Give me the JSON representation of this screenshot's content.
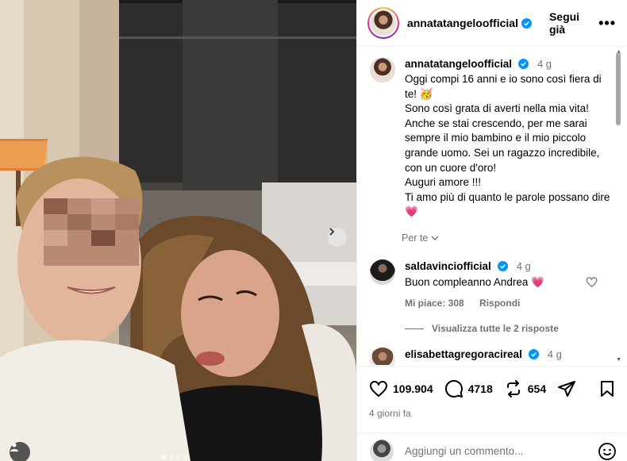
{
  "post": {
    "author": "annatatangeloofficial",
    "follow_label": "Segui già",
    "more_label": "•••"
  },
  "caption": {
    "author": "annatatangeloofficial",
    "time": "4 g",
    "lines": [
      "Oggi compi 16 anni e io sono così fiera di te! 🥳",
      "Sono così grata di averti nella mia vita! Anche se stai crescendo, per me sarai sempre il mio bambino e il mio piccolo grande uomo. Sei un ragazzo incredibile, con un cuore d'oro!",
      "Auguri amore !!!",
      "Ti amo più di quanto le parole possano dire💗"
    ],
    "translate_label": "Per te"
  },
  "comments": [
    {
      "author": "saldavinciofficial",
      "time": "4 g",
      "text": "Buon compleanno Andrea 💗",
      "likes_label": "Mi piace: 308",
      "reply_label": "Rispondi"
    },
    {
      "author": "elisabettagregoracireal",
      "time": "4 g"
    }
  ],
  "view_replies_label": "Visualizza tutte le 2 risposte",
  "actions": {
    "likes": "109.904",
    "comments": "4718",
    "reposts": "654"
  },
  "posted_ago": "4 giorni fa",
  "add_comment_placeholder": "Aggiungi un commento...",
  "colors": {
    "verified": "#0095f6",
    "heart": "#ff3040",
    "muted_text": "#737373"
  },
  "carousel": {
    "slide_count": 4,
    "current_slide": 1
  }
}
